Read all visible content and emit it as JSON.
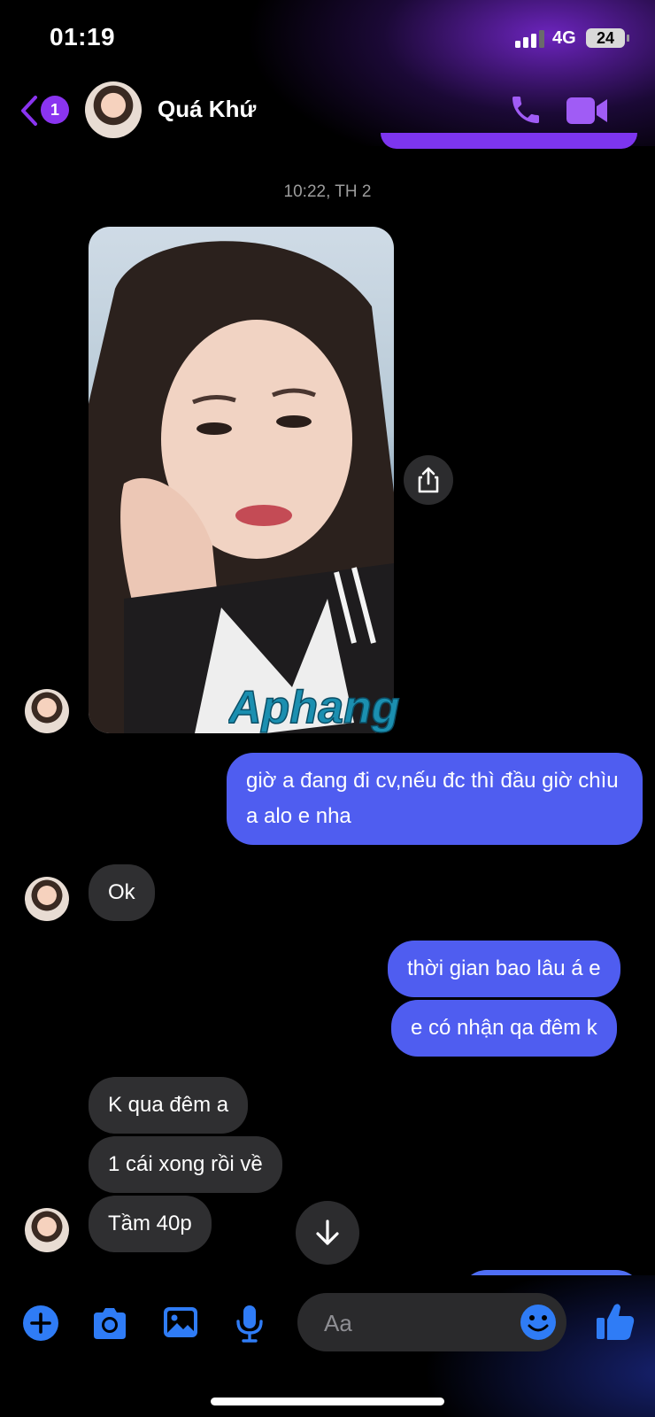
{
  "status_bar": {
    "time": "01:19",
    "network": "4G",
    "battery": "24"
  },
  "header": {
    "back_badge": "1",
    "contact_name": "Quá Khứ"
  },
  "conversation": {
    "timestamp": "10:22, TH 2",
    "watermark": "Aphang",
    "messages": [
      {
        "side": "out",
        "text": "giờ a đang đi cv,nếu đc thì đầu giờ chìu a alo e nha"
      },
      {
        "side": "in",
        "text": "Ok"
      },
      {
        "side": "out",
        "text": "thời gian bao lâu á e"
      },
      {
        "side": "out",
        "text": "e có nhận qa đêm k"
      },
      {
        "side": "in",
        "text": "K qua đêm a"
      },
      {
        "side": "in",
        "text": "1 cái xong rồi về"
      },
      {
        "side": "in",
        "text": "Tầm 40p"
      }
    ]
  },
  "composer": {
    "placeholder": "Aa"
  },
  "icons": {
    "back": "chevron-left-icon",
    "call": "phone-icon",
    "video": "video-camera-icon",
    "share": "share-icon",
    "scroll": "arrow-down-icon",
    "plus": "plus-circle-icon",
    "camera": "camera-icon",
    "gallery": "image-icon",
    "mic": "microphone-icon",
    "emoji": "emoji-icon",
    "like": "thumbs-up-icon"
  },
  "colors": {
    "accent_purple": "#8a34f0",
    "outgoing_bubble": "#4f5df0",
    "incoming_bubble": "#2f2f31",
    "composer_blue": "#2f7cf6"
  }
}
